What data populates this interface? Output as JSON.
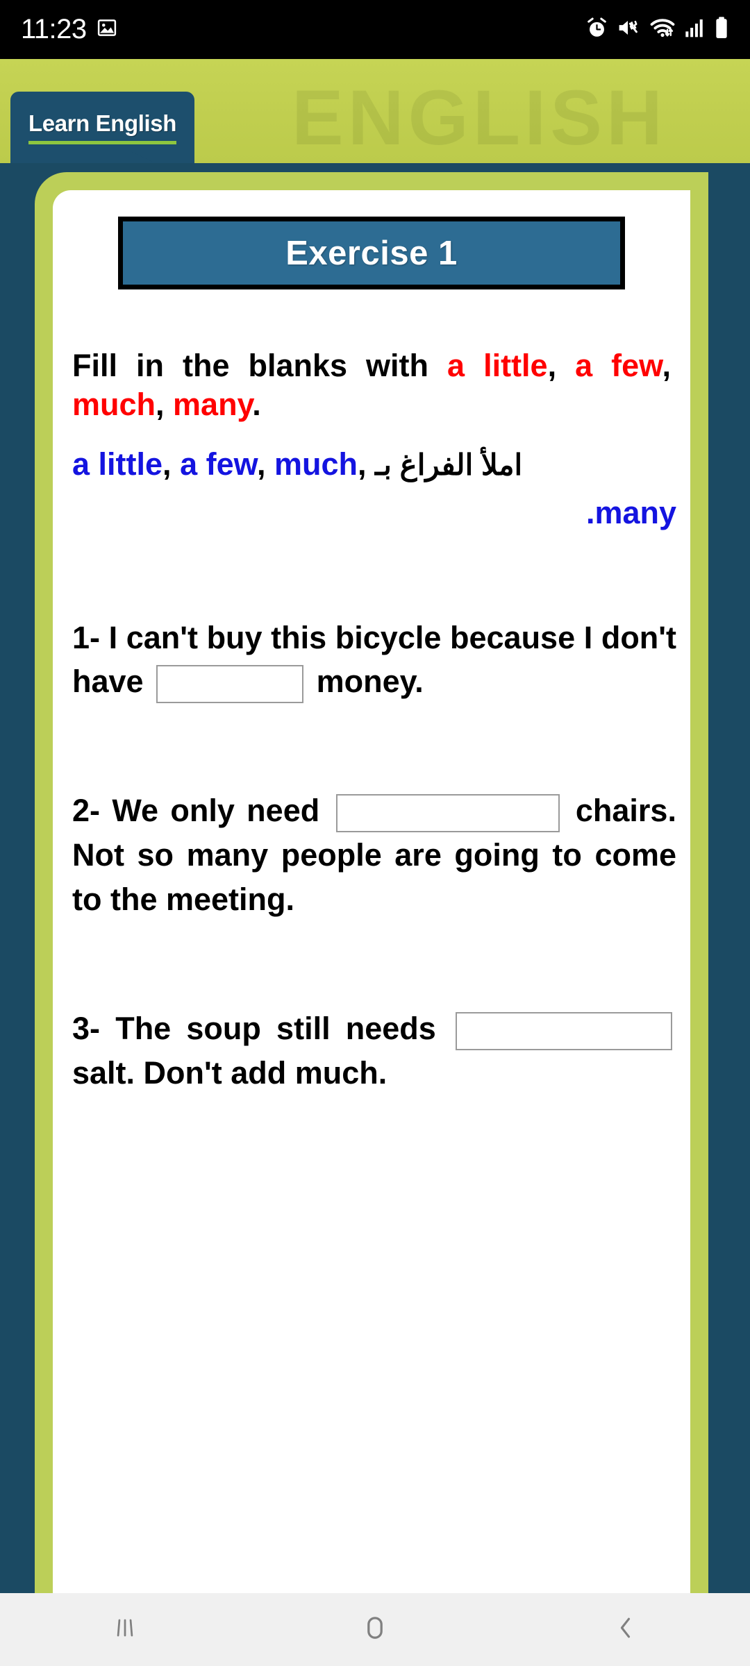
{
  "status_bar": {
    "time": "11:23",
    "left_icons": [
      "image-icon"
    ],
    "right_icons": [
      "alarm-icon",
      "mute-vibrate-icon",
      "wifi-icon",
      "signal-icon",
      "battery-icon"
    ]
  },
  "app_header": {
    "brand_tab_label": "Learn English",
    "watermark_text": "ENGLISH",
    "background_color": "#c0ce4f",
    "tab_color": "#1d4f6d",
    "tab_underline_color": "#8ec63f"
  },
  "card": {
    "border_color": "#bccf58",
    "background_color": "#ffffff",
    "page_background_color": "#1b4a63"
  },
  "exercise": {
    "title": "Exercise 1",
    "title_box_fill": "#2d6c93",
    "title_box_border": "#000000",
    "instruction": {
      "part1": "Fill in the blanks with ",
      "kw1": "a little",
      "sep1": ", ",
      "kw2": "a few",
      "sep2": ", ",
      "kw3": "much",
      "sep3": ", ",
      "kw4": "many",
      "end": "."
    },
    "instruction_arabic": {
      "kw1": "a little",
      "sep1": ", ",
      "kw2": "a few",
      "sep2": ", ",
      "kw3": "much",
      "sep3": ", ",
      "arabic": "املأ الفراغ بـ",
      "tail": ".many"
    },
    "accent_red": "#ff0000",
    "accent_blue": "#1414e0",
    "questions": [
      {
        "number": "1-",
        "before": "I can't buy this bicycle because I don't have",
        "after": "money.",
        "blank_value": "",
        "blank_placeholder": ""
      },
      {
        "number": "2-",
        "before": "We only need",
        "after": "chairs. Not so many people are going to come to the meeting.",
        "blank_value": "",
        "blank_placeholder": ""
      },
      {
        "number": "3-",
        "before": "The soup still needs",
        "after": "salt. Don't add much.",
        "blank_value": "",
        "blank_placeholder": ""
      }
    ]
  },
  "nav_bar": {
    "recents_label": "recents-icon",
    "home_label": "home-icon",
    "back_label": "back-icon",
    "background_color": "#f0f0f0",
    "icon_color": "#808080"
  }
}
